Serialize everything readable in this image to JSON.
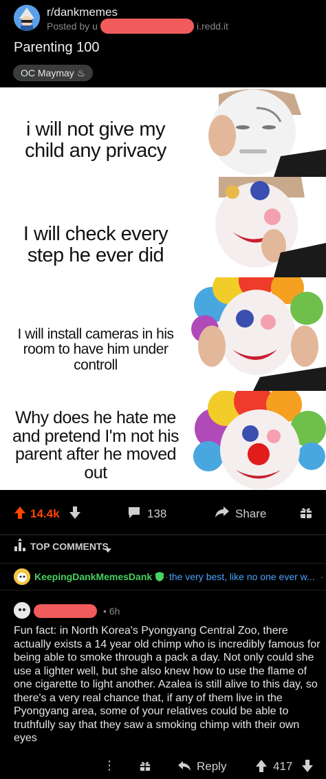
{
  "header": {
    "subreddit": "r/dankmemes",
    "posted_by": "Posted by u",
    "domain": "i.redd.it",
    "title": "Parenting 100",
    "flair": "OC Maymay ♨"
  },
  "meme": {
    "panels": [
      {
        "text": "i will not give my child any privacy"
      },
      {
        "text": "I will check every step he ever did"
      },
      {
        "text": "I will install cameras in his room to have him under controll"
      },
      {
        "text": "Why does he hate me and pretend I'm not his parent after he moved out"
      }
    ]
  },
  "post_actions": {
    "upvotes": "14.4k",
    "comments": "138",
    "share_label": "Share"
  },
  "comments_section": {
    "sort_label": "TOP COMMENTS"
  },
  "sticky_comment": {
    "author": "KeepingDankMemesDank",
    "author_flair": "the very best, like no one ever w..."
  },
  "comment": {
    "time": "• 6h",
    "body": "Fun fact: in North Korea's Pyongyang Central Zoo, there actually exists a 14 year old chimp who is incredibly famous for being able to smoke through a pack a day. Not only could she use a lighter well, but she also knew how to use the flame of one cigarette to light another. Azalea is still alive to this day, so there's a very real chance that, if any of them live in the Pyongyang area, some of your relatives could be able to truthfully say that they saw a smoking chimp with their own eyes",
    "reply_label": "Reply",
    "votes": "417"
  },
  "colors": {
    "upvote_orange": "#ff4500",
    "mod_green": "#46d160",
    "flair_blue": "#4aa3ff",
    "redaction": "#f25b5b"
  }
}
